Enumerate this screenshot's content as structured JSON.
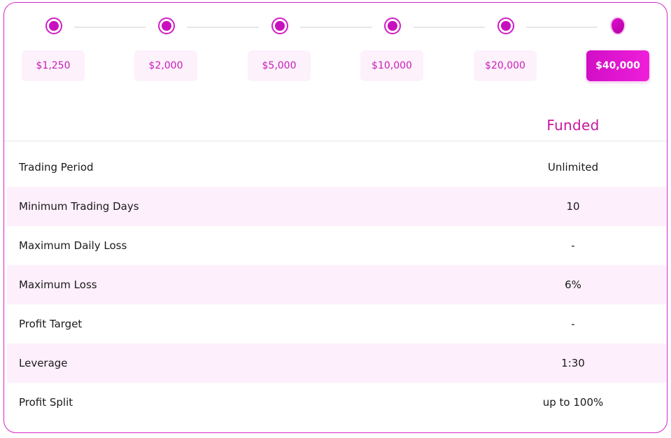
{
  "stepper": {
    "amounts": [
      "$1,250",
      "$2,000",
      "$5,000",
      "$10,000",
      "$20,000",
      "$40,000"
    ],
    "selected": "$40,000"
  },
  "table": {
    "column_header": "Funded",
    "rows": [
      {
        "label": "Trading Period",
        "value": "Unlimited"
      },
      {
        "label": "Minimum Trading Days",
        "value": "10"
      },
      {
        "label": "Maximum Daily Loss",
        "value": "-"
      },
      {
        "label": "Maximum Loss",
        "value": "6%"
      },
      {
        "label": "Profit Target",
        "value": "-"
      },
      {
        "label": "Leverage",
        "value": "1:30"
      },
      {
        "label": "Profit Split",
        "value": "up to 100%"
      }
    ]
  },
  "colors": {
    "accent": "#d21cc4",
    "row_alt": "#fdeffc",
    "button_bg": "#fdf1fc"
  }
}
